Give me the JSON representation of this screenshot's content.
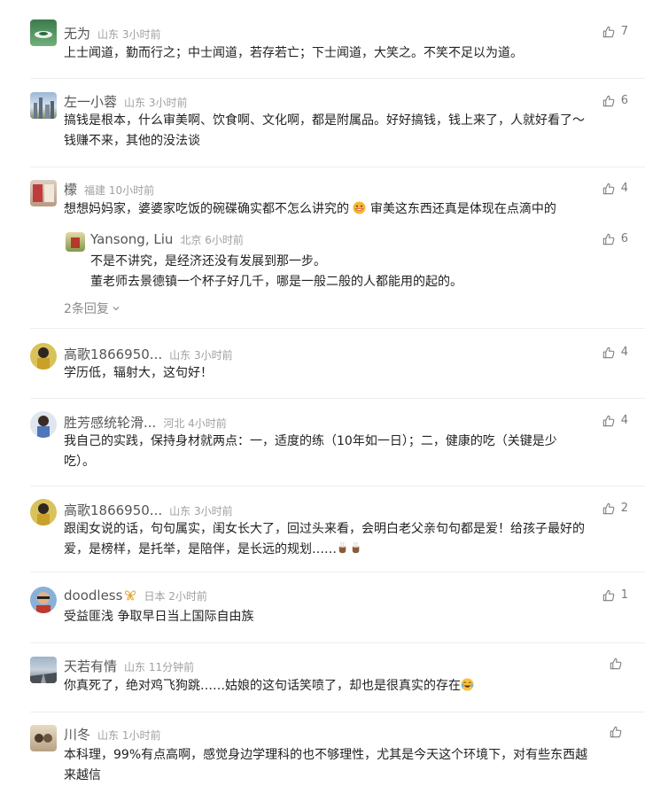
{
  "comments": [
    {
      "name": "无为",
      "location": "山东",
      "time": "3小时前",
      "likes": "7",
      "lines": [
        "上士闻道，勤而行之；中士闻道，若存若亡；下士闻道，大笑之。不笑不足以为道。"
      ]
    },
    {
      "name": "左一小蓉",
      "location": "山东",
      "time": "3小时前",
      "likes": "6",
      "lines": [
        "搞钱是根本，什么审美啊、饮食啊、文化啊，都是附属品。好好搞钱，钱上来了，人就好看了～",
        "钱赚不来，其他的没法谈"
      ]
    },
    {
      "name": "檬",
      "location": "福建",
      "time": "10小时前",
      "likes": "4",
      "text_before": "想想妈妈家，婆婆家吃饭的碗碟确实都不怎么讲究的",
      "emoji": "grinning-face-emoji",
      "text_after": "审美这东西还真是体现在点滴中的"
    },
    {
      "name": "高歌1866950...",
      "location": "山东",
      "time": "3小时前",
      "likes": "4",
      "lines": [
        "学历低，辐射大，这句好！"
      ]
    },
    {
      "name": "胜芳感统轮滑...",
      "location": "河北",
      "time": "4小时前",
      "likes": "4",
      "lines": [
        "我自己的实践，保持身材就两点：一，适度的练（10年如一日）；二，健康的吃（关键是少",
        "吃）。"
      ]
    },
    {
      "name": "高歌1866950...",
      "location": "山东",
      "time": "3小时前",
      "likes": "2",
      "line1": "跟闺女说的话，句句属实，闺女长大了，回过头来看，会明白老父亲句句都是爱！给孩子最好的",
      "line2": "爱，是榜样，是托举，是陪伴，是长远的规划……",
      "emoji": "coffee-emoji"
    },
    {
      "name": "doodless",
      "location": "日本",
      "time": "2小时前",
      "likes": "1",
      "badge": "butterfly-badge-icon",
      "lines": [
        "受益匪浅 争取早日当上国际自由族"
      ]
    },
    {
      "name": "天若有情",
      "location": "山东",
      "time": "11分钟前",
      "likes": "",
      "text": "你真死了，绝对鸡飞狗跳……姑娘的这句话笑喷了，却也是很真实的存在",
      "emoji": "laughing-tears-emoji"
    },
    {
      "name": "川冬",
      "location": "山东",
      "time": "1小时前",
      "likes": "",
      "lines": [
        "本科理，99%有点高啊，感觉身边学理科的也不够理性，尤其是今天这个环境下，对有些东西越",
        "来越信"
      ]
    }
  ],
  "reply": {
    "name": "Yansong, Liu",
    "location": "北京",
    "time": "6小时前",
    "likes": "6",
    "lines": [
      "不是不讲究，是经济还没有发展到那一步。",
      "董老师去景德镇一个杯子好几千，哪是一般二般的人都能用的起的。"
    ]
  },
  "more_replies": "2条回复",
  "icons": {
    "like": "thumbs-up-icon",
    "expand": "chevron-down-icon"
  },
  "colors": {
    "name": "#555555",
    "meta": "#a0a0a0",
    "text": "#222222",
    "divider": "#eeeeee"
  }
}
